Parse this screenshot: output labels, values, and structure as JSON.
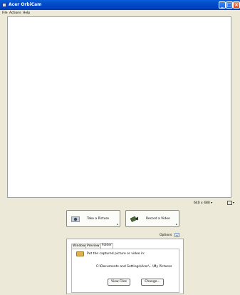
{
  "window": {
    "title": "Acer OrbiCam",
    "min_label": "_",
    "max_label": "□",
    "close_label": "×"
  },
  "menu": [
    "File",
    "Actions",
    "Help"
  ],
  "resolution": {
    "value": "640 x 480",
    "arrow": "▾"
  },
  "snapshot": {
    "arrow": "▾"
  },
  "actions": {
    "take_picture": "Take a Picture",
    "record_video": "Record a Video",
    "drop": "▸"
  },
  "options": {
    "label": "Options",
    "toggle": "«",
    "tabs": [
      "Window",
      "Preview",
      "Folder"
    ],
    "active_tab": "Folder",
    "folder_prompt": "Put the captured picture or video in:",
    "folder_path": "C:\\Documents and Settings\\Acer\\...\\My Pictures",
    "view_files": "View Files",
    "change": "Change..."
  }
}
